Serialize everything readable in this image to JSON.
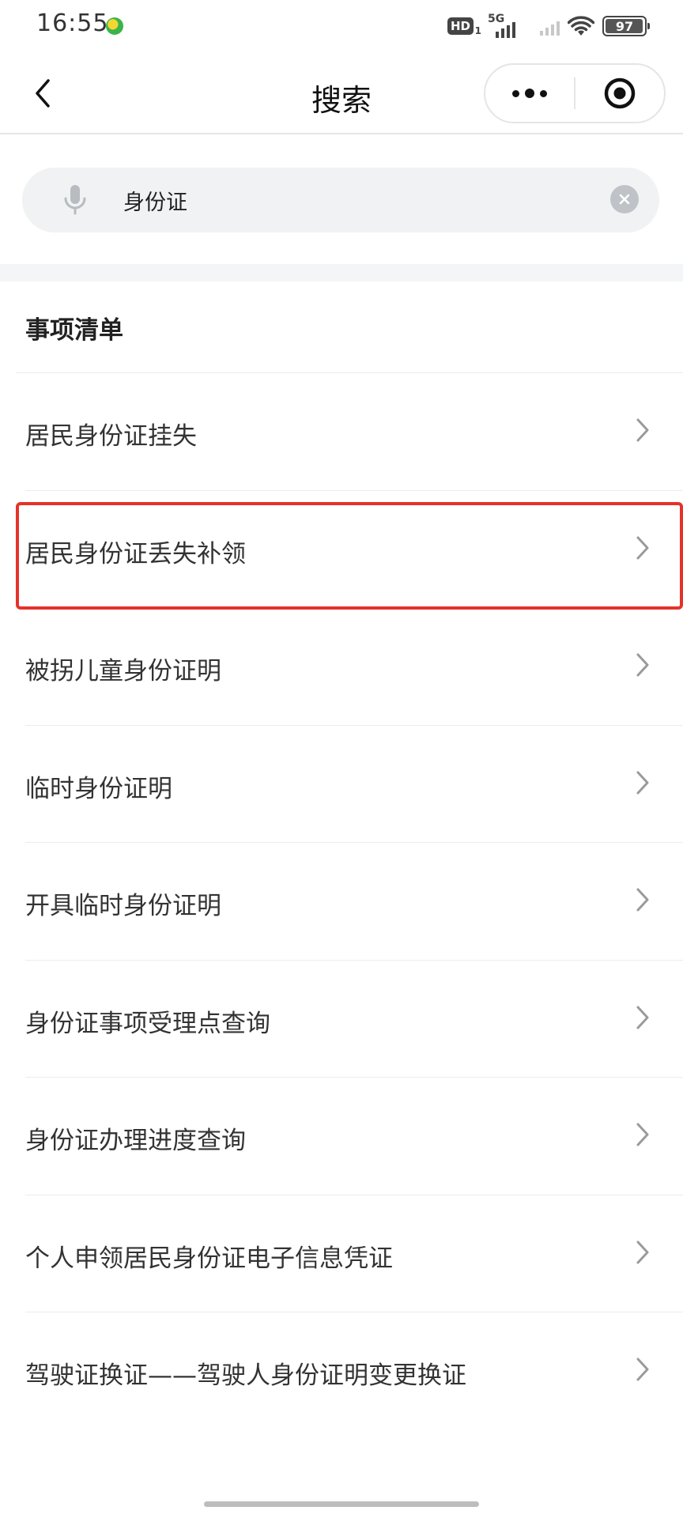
{
  "status_bar": {
    "time": "16:55",
    "hd_label": "HD",
    "hd_sub": "1",
    "network": "5G",
    "battery": "97"
  },
  "nav": {
    "title": "搜索"
  },
  "search": {
    "value": "身份证",
    "placeholder": ""
  },
  "section": {
    "title": "事项清单"
  },
  "items": [
    {
      "label": "居民身份证挂失"
    },
    {
      "label": "居民身份证丢失补领",
      "highlighted": true
    },
    {
      "label": "被拐儿童身份证明"
    },
    {
      "label": "临时身份证明"
    },
    {
      "label": "开具临时身份证明"
    },
    {
      "label": "身份证事项受理点查询"
    },
    {
      "label": "身份证办理进度查询"
    },
    {
      "label": "个人申领居民身份证电子信息凭证"
    },
    {
      "label": "驾驶证换证——驾驶人身份证明变更换证"
    }
  ],
  "colors": {
    "highlight_border": "#e53229",
    "search_bg": "#f1f2f3"
  },
  "icons": {
    "back": "chevron-left-icon",
    "more": "more-dots-icon",
    "close": "target-circle-icon",
    "mic": "microphone-icon",
    "clear": "clear-x-icon",
    "item_arrow": "chevron-right-icon"
  }
}
